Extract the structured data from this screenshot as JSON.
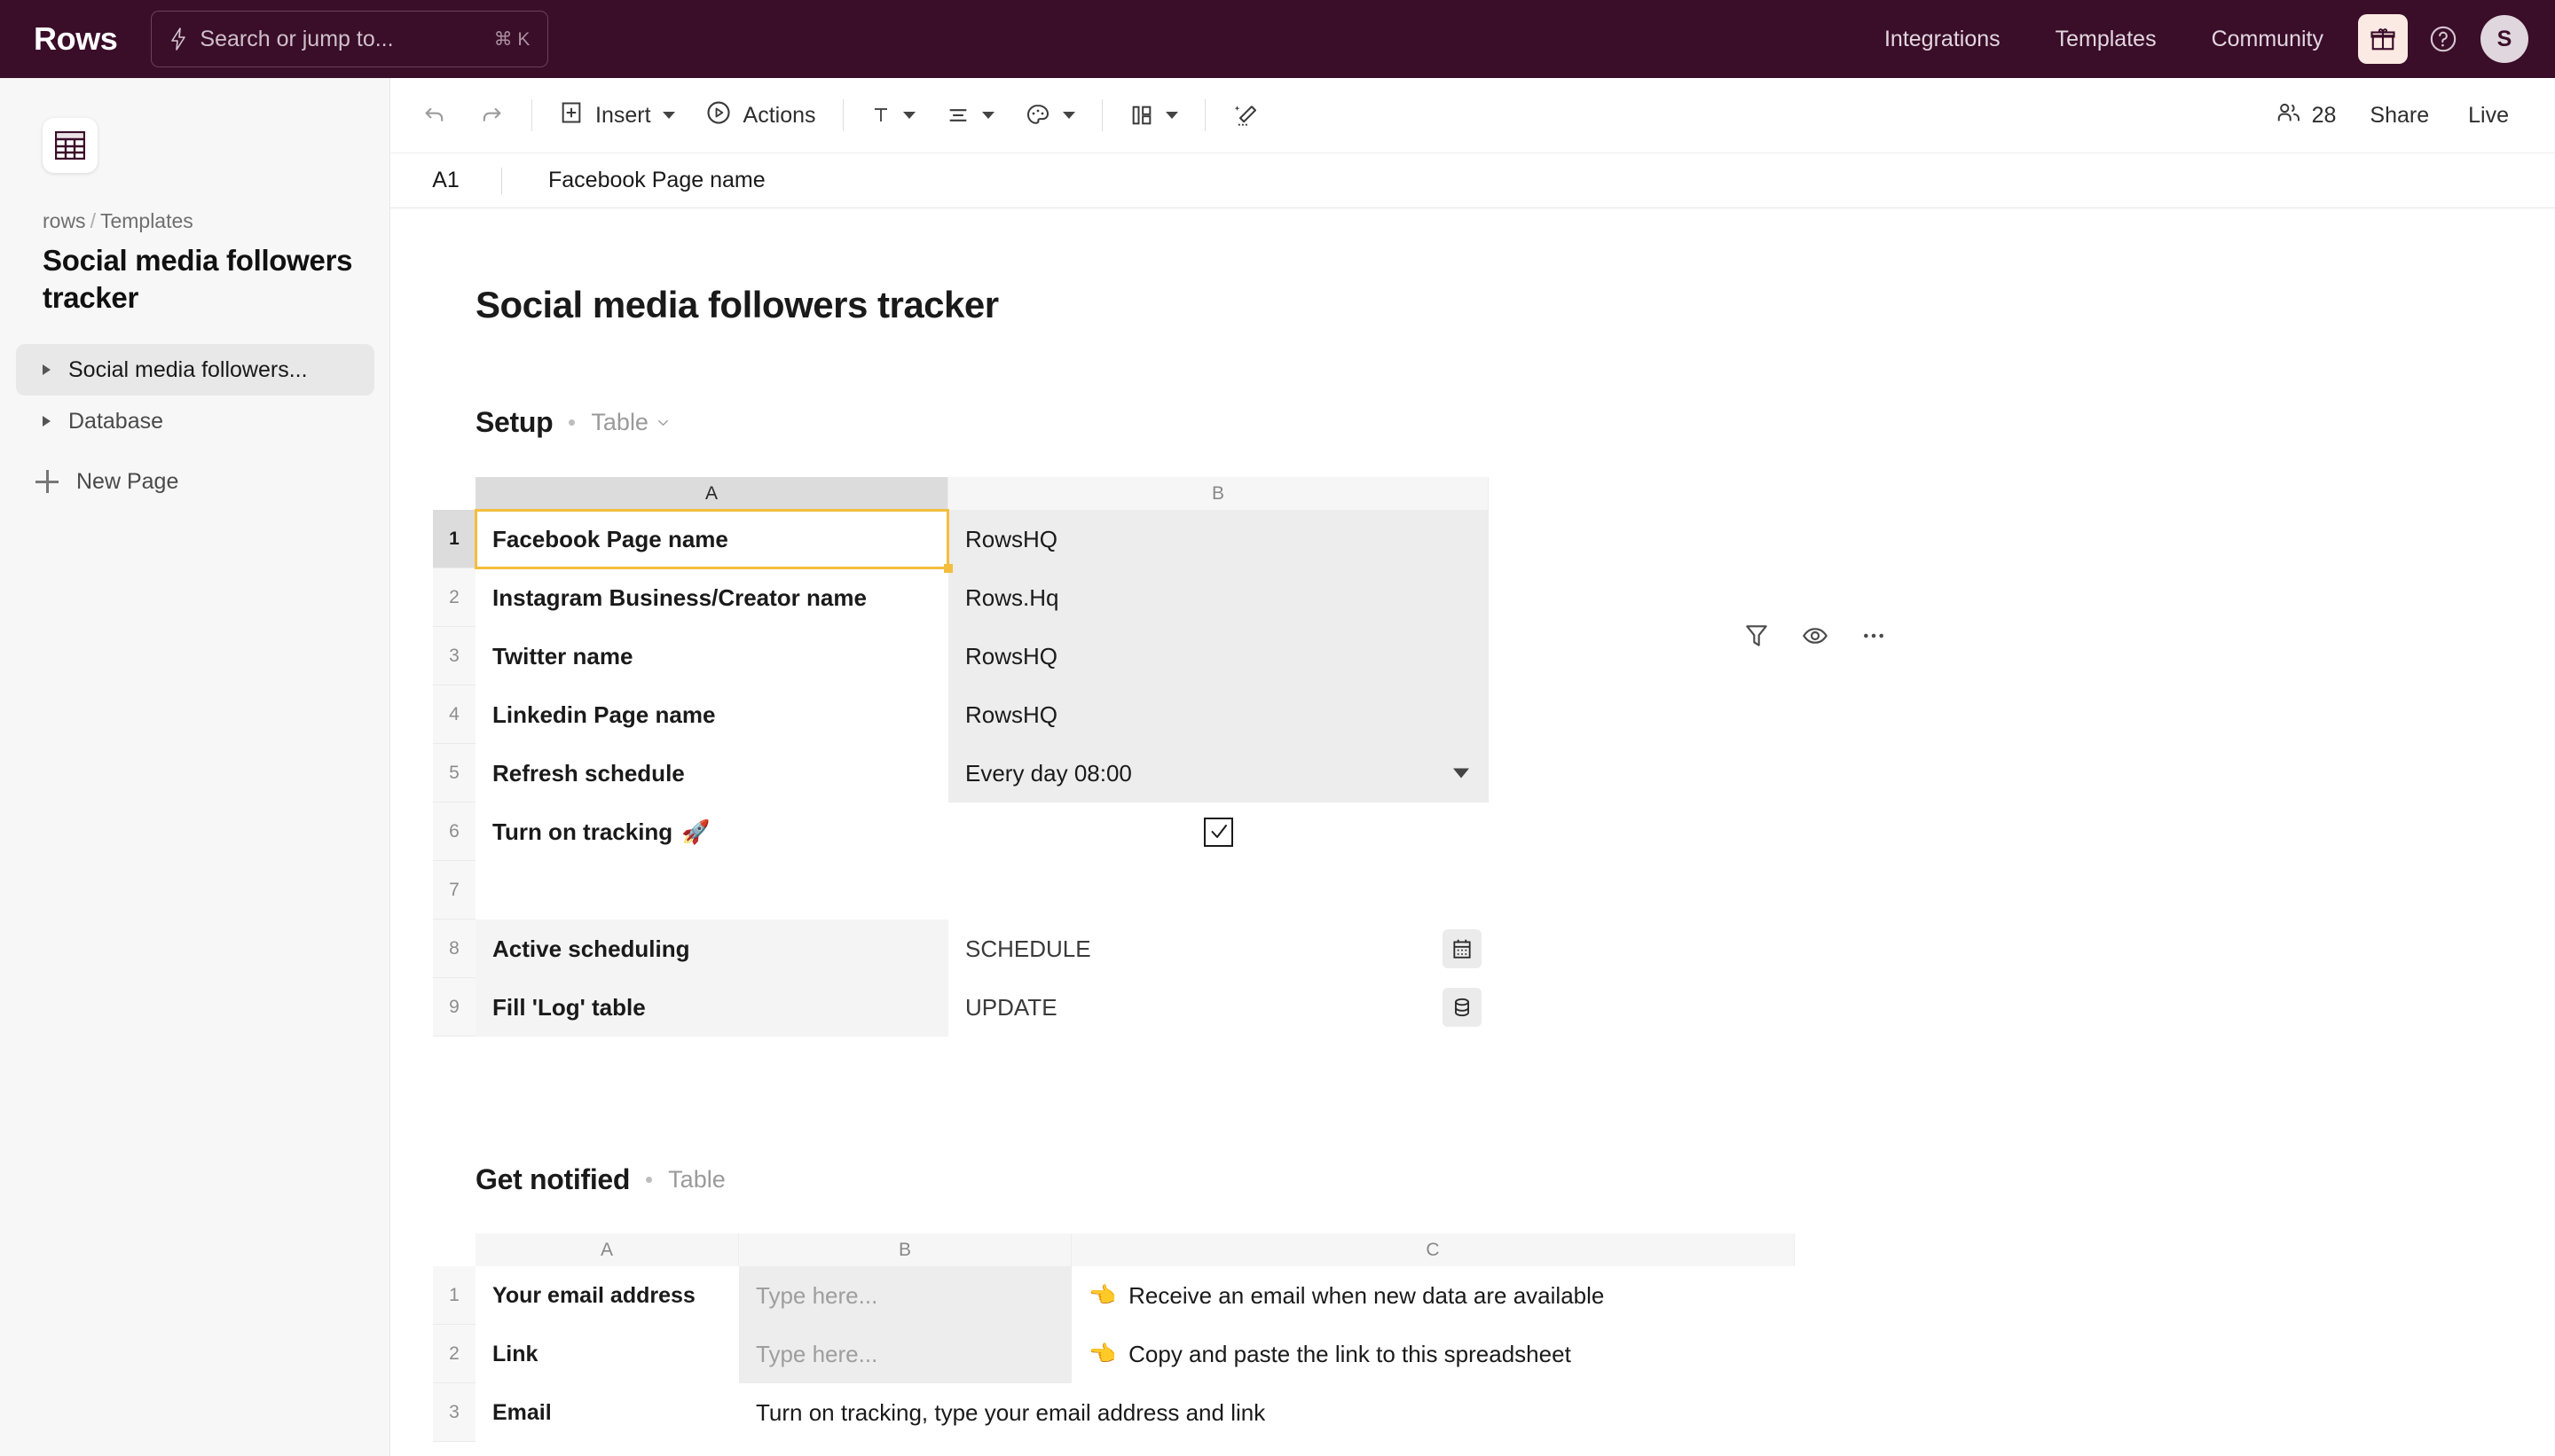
{
  "topbar": {
    "brand": "Rows",
    "search": {
      "placeholder": "Search or jump to...",
      "shortcut": "⌘ K",
      "icon": "lightning-bolt-icon"
    },
    "nav": [
      {
        "label": "Integrations"
      },
      {
        "label": "Templates"
      },
      {
        "label": "Community"
      }
    ],
    "gift_icon": "gift-icon",
    "help_icon": "question-circle-icon",
    "avatar_initial": "S",
    "colors": {
      "background": "#3A0D29",
      "gift_button": "#FBEAE3",
      "avatar": "#E0D6DD"
    }
  },
  "sidebar": {
    "app_icon": "spreadsheet-grid-icon",
    "breadcrumb": {
      "workspace": "rows",
      "separator": "/",
      "folder": "Templates"
    },
    "doc_title": "Social media followers tracker",
    "pages": [
      {
        "label": "Social media followers...",
        "active": true
      },
      {
        "label": "Database",
        "active": false
      }
    ],
    "new_page_label": "New Page"
  },
  "toolbar": {
    "undo_icon": "undo-arrow-icon",
    "redo_icon": "redo-arrow-icon",
    "insert_label": "Insert",
    "insert_icon": "plus-box-icon",
    "actions_label": "Actions",
    "actions_icon": "play-circle-icon",
    "text_icon": "text-format-icon",
    "align_icon": "align-icon",
    "palette_icon": "color-palette-icon",
    "layout_icon": "cell-layout-icon",
    "clear_format_icon": "clear-formatting-icon",
    "collaborators_icon": "people-icon",
    "collaborators_count": "28",
    "share_label": "Share",
    "live_label": "Live"
  },
  "formula_bar": {
    "cell_reference": "A1",
    "value": "Facebook Page name"
  },
  "sheet": {
    "title": "Social media followers tracker"
  },
  "sections": [
    {
      "name": "Setup",
      "type_label": "Table",
      "tools": [
        "filter-icon",
        "eye-icon",
        "more-options-icon"
      ],
      "columns": [
        "A",
        "B"
      ],
      "rows": [
        {
          "n": "1",
          "a": "Facebook Page name",
          "b": "RowsHQ"
        },
        {
          "n": "2",
          "a": "Instagram Business/Creator name",
          "b": "Rows.Hq"
        },
        {
          "n": "3",
          "a": "Twitter name",
          "b": "RowsHQ"
        },
        {
          "n": "4",
          "a": "Linkedin Page name",
          "b": "RowsHQ"
        },
        {
          "n": "5",
          "a": "Refresh schedule",
          "b": "Every day 08:00"
        },
        {
          "n": "6",
          "a": "Turn on tracking",
          "a_emoji": "🚀",
          "b": ""
        },
        {
          "n": "7",
          "a": "",
          "b": ""
        },
        {
          "n": "8",
          "a": "Active scheduling",
          "b": "SCHEDULE",
          "b_icon": "calendar-icon"
        },
        {
          "n": "9",
          "a": "Fill 'Log' table",
          "b": "UPDATE",
          "b_icon": "database-icon"
        }
      ],
      "selected_cell": "A1",
      "checkbox_checked": true
    },
    {
      "name": "Get notified",
      "type_label": "Table",
      "columns": [
        "A",
        "B",
        "C"
      ],
      "rows": [
        {
          "n": "1",
          "a": "Your email address",
          "b": "",
          "b_placeholder": "Type here...",
          "c_emoji": "👈",
          "c": "Receive an email when new data are available"
        },
        {
          "n": "2",
          "a": "Link",
          "b": "",
          "b_placeholder": "Type here...",
          "c_emoji": "👈",
          "c": "Copy and paste the link to this spreadsheet"
        },
        {
          "n": "3",
          "a": "Email",
          "b": "Turn on tracking, type your email address and link",
          "c": ""
        }
      ]
    }
  ],
  "colors": {
    "selection_yellow": "#F3BE3E",
    "brand_purple": "#3A0D29"
  }
}
